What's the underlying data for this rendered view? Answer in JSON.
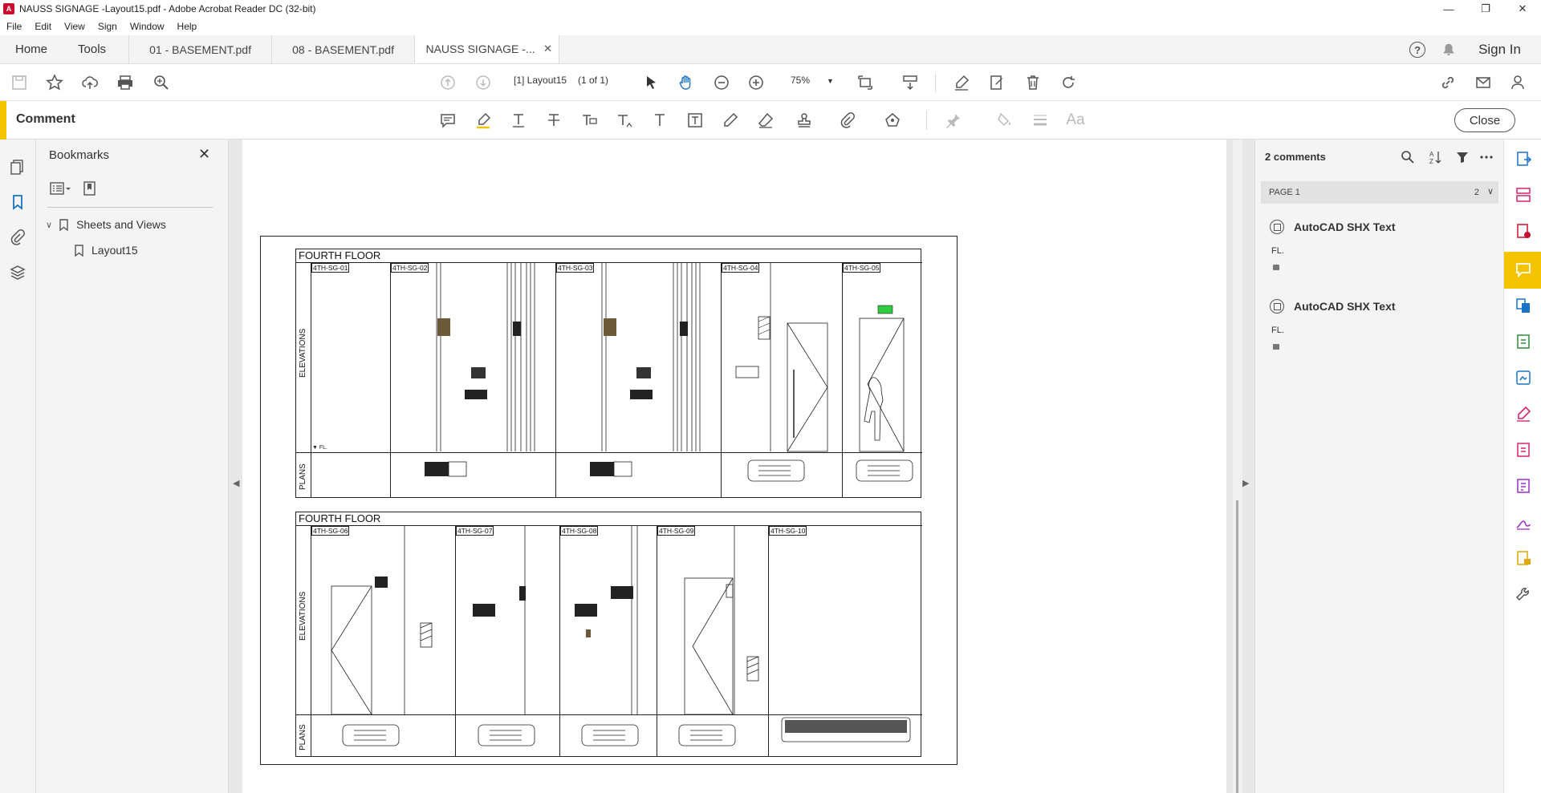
{
  "window": {
    "title": "NAUSS SIGNAGE -Layout15.pdf - Adobe Acrobat Reader DC (32-bit)"
  },
  "menu": [
    "File",
    "Edit",
    "View",
    "Sign",
    "Window",
    "Help"
  ],
  "nav_tabs": {
    "home": "Home",
    "tools": "Tools"
  },
  "doc_tabs": [
    {
      "label": "01 - BASEMENT.pdf"
    },
    {
      "label": "08 - BASEMENT.pdf"
    },
    {
      "label": "NAUSS SIGNAGE -..."
    }
  ],
  "header": {
    "sign_in": "Sign In",
    "help": "?"
  },
  "toolbar": {
    "page_label": "[1] Layout15",
    "page_count": "(1 of 1)",
    "zoom": "75%"
  },
  "comment_bar": {
    "label": "Comment",
    "close": "Close",
    "font_tool": "Aa"
  },
  "bookmarks": {
    "title": "Bookmarks",
    "items": [
      {
        "label": "Sheets and Views"
      },
      {
        "label": "Layout15"
      }
    ]
  },
  "drawing": {
    "panels": [
      {
        "title": "FOURTH FLOOR",
        "tags": [
          "4TH-SG-01",
          "4TH-SG-02",
          "4TH-SG-03",
          "4TH-SG-04",
          "4TH-SG-05"
        ]
      },
      {
        "title": "FOURTH FLOOR",
        "tags": [
          "4TH-SG-06",
          "4TH-SG-07",
          "4TH-SG-08",
          "4TH-SG-09",
          "4TH-SG-10"
        ]
      }
    ],
    "side_labels": {
      "elevations": "ELEVATIONS",
      "plans": "PLANS"
    },
    "fl_label": "FL."
  },
  "comments": {
    "count_label": "2 comments",
    "page_group": {
      "label": "PAGE 1",
      "count": "2"
    },
    "items": [
      {
        "author": "AutoCAD SHX Text",
        "body": "FL."
      },
      {
        "author": "AutoCAD SHX Text",
        "body": "FL."
      }
    ]
  },
  "colors": {
    "accent": "#f5c400",
    "brand_red": "#c8102e",
    "tool_pink": "#d6246e",
    "tool_blue": "#1a73c7",
    "tool_green": "#2e8b3a"
  }
}
